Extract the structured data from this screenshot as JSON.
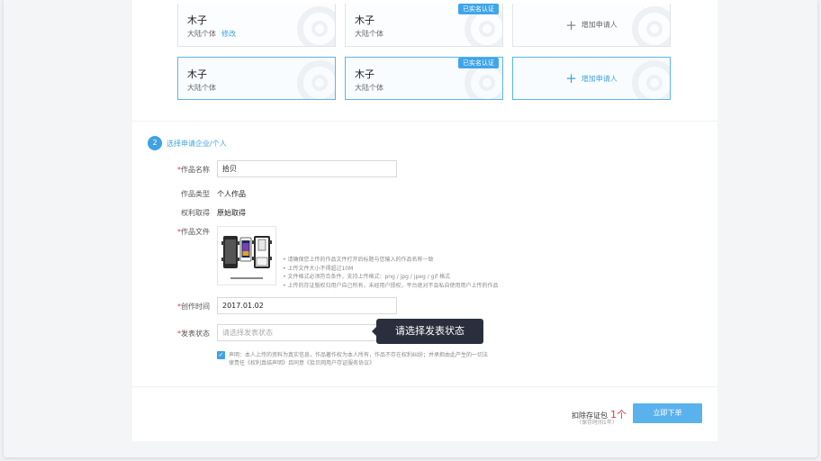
{
  "applicants": [
    {
      "name": "木子",
      "type": "大陆个体",
      "edit_label": "修改",
      "selected": false,
      "verified": false
    },
    {
      "name": "木子",
      "type": "大陆个体",
      "edit_label": "",
      "selected": false,
      "verified": true
    },
    {
      "name": "木子",
      "type": "大陆个体",
      "edit_label": "",
      "selected": true,
      "verified": false
    },
    {
      "name": "木子",
      "type": "大陆个体",
      "edit_label": "",
      "selected": true,
      "verified": true
    }
  ],
  "badge_label": "已实名认证",
  "add_applicant_label": "增加申请人",
  "step": {
    "number": "2",
    "title": "选择申请企业/个人"
  },
  "form": {
    "required_mark": "*",
    "work_name_label": "作品名称",
    "work_name_value": "拾贝",
    "work_type_label": "作品类型",
    "work_type_value": "个人作品",
    "rights_label": "权利取得",
    "rights_value": "原始取得",
    "work_file_label": "作品文件",
    "file_hints": [
      "• 请确保您上传的作品文件打开后标题与您输入的作品名称一致",
      "• 上传文件大小不得超过10M",
      "• 文件格式必须符合条件，支持上传格式：png / jpg / jpeg / gif 格式",
      "• 上传的存证版权归用户自己所有，未经用户授权，平台绝对不会私自使用用户上传的作品"
    ],
    "create_time_label": "创作时间",
    "create_time_value": "2017.01.02",
    "publish_status_label": "发表状态",
    "publish_status_placeholder": "请选择发表状态",
    "tooltip": "请选择发表状态",
    "agreement_lines": [
      "声明：本人上传的资料为真实信息，作品著作权为本人所有，作品不存在权利纠纷；并承担由此产生的一切法",
      "律责任《权利真结声明》且同意《拾贝网用户存证服务协议》"
    ],
    "agree_checked": true
  },
  "footer": {
    "deduct_label": "扣除存证包",
    "deduct_count": "1个",
    "deduct_sub": "（保存时间1年）",
    "order_button": "立即下单"
  },
  "colors": {
    "accent": "#3fa2e3",
    "required": "#e0393e",
    "tooltip_bg": "#2b2f3d"
  }
}
